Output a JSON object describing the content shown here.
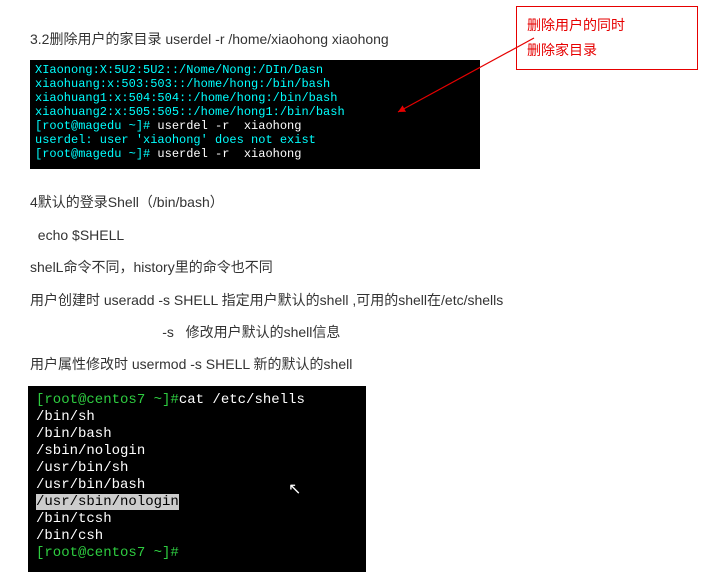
{
  "callout": {
    "line1": "删除用户的同时",
    "line2": "删除家目录"
  },
  "heading1": "3.2删除用户的家目录  userdel  -r  /home/xiaohong     xiaohong",
  "term1": {
    "l1a": "XIaonong:X:5U2:5U2::/Nome/Nong:/DIn/Dasn",
    "l2": "xiaohuang:x:503:503::/home/hong:/bin/bash",
    "l3": "xiaohuang1:x:504:504::/home/hong:/bin/bash",
    "l4": "xiaohuang2:x:505:505::/home/hong1:/bin/bash",
    "l5a": "[root@magedu ~]# ",
    "l5b": "userdel -r  xiaohong",
    "l6": "userdel: user 'xiaohong' does not exist",
    "l7a": "[root@magedu ~]# ",
    "l7b": "userdel -r  xiaohong"
  },
  "body": {
    "p1": "4默认的登录Shell（/bin/bash）",
    "p2": "  echo $SHELL",
    "p3": "shelL命令不同，history里的命令也不同",
    "p4": "用户创建时 useradd   -s   SHELL 指定用户默认的shell ,可用的shell在/etc/shells",
    "p5": "                                  -s   修改用户默认的shell信息",
    "p6": "用户属性修改时  usermod -s SHELL  新的默认的shell"
  },
  "term2": {
    "l1a": "[root@centos7 ~]#",
    "l1b": "cat /etc/shells",
    "l2": "/bin/sh",
    "l3": "/bin/bash",
    "l4": "/sbin/nologin",
    "l5": "/usr/bin/sh",
    "l6": "/usr/bin/bash",
    "l7": "/usr/sbin/nologin",
    "l8": "/bin/tcsh",
    "l9": "/bin/csh",
    "l10": "[root@centos7 ~]#"
  }
}
